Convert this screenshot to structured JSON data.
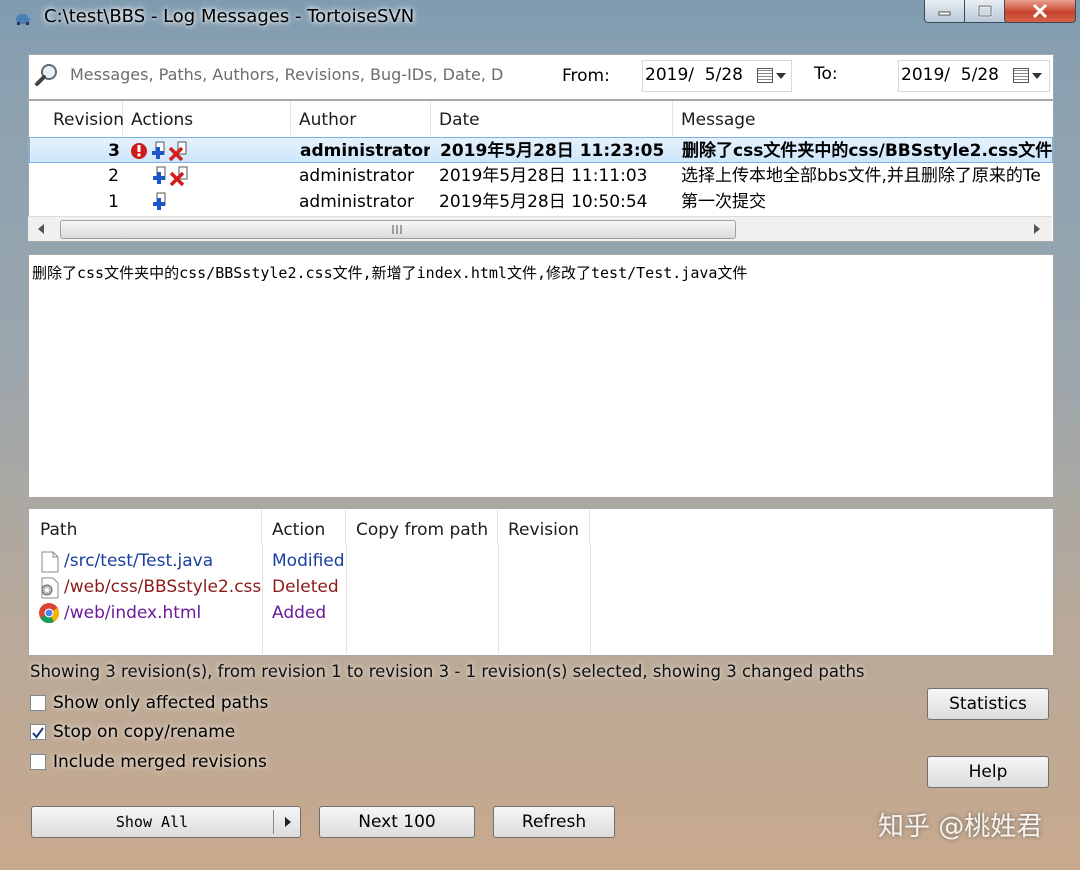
{
  "window": {
    "title": "C:\\test\\BBS - Log Messages - TortoiseSVN"
  },
  "search": {
    "placeholder": "Messages, Paths, Authors, Revisions, Bug-IDs, Date, D",
    "from_label": "From:",
    "from_value": "2019/  5/28",
    "to_label": "To:",
    "to_value": "2019/  5/28"
  },
  "revisions": {
    "headers": [
      "Revision",
      "Actions",
      "Author",
      "Date",
      "Message"
    ],
    "rows": [
      {
        "revision": "3",
        "author": "administrator",
        "date": "2019年5月28日 11:23:05",
        "message": "删除了css文件夹中的css/BBSstyle2.css文件",
        "actions": [
          "conflict",
          "add",
          "delete"
        ],
        "selected": true
      },
      {
        "revision": "2",
        "author": "administrator",
        "date": "2019年5月28日 11:11:03",
        "message": "选择上传本地全部bbs文件,并且删除了原来的Te",
        "actions": [
          "add",
          "delete"
        ],
        "selected": false
      },
      {
        "revision": "1",
        "author": "administrator",
        "date": "2019年5月28日 10:50:54",
        "message": "第一次提交",
        "actions": [
          "add"
        ],
        "selected": false
      }
    ]
  },
  "message_text": "删除了css文件夹中的css/BBSstyle2.css文件,新增了index.html文件,修改了test/Test.java文件",
  "paths": {
    "headers": [
      "Path",
      "Action",
      "Copy from path",
      "Revision"
    ],
    "rows": [
      {
        "path": "/src/test/Test.java",
        "action": "Modified",
        "color": "#1b3f9e",
        "icon": "file-icon"
      },
      {
        "path": "/web/css/BBSstyle2.css",
        "action": "Deleted",
        "color": "#8b1a1a",
        "icon": "css-file-icon"
      },
      {
        "path": "/web/index.html",
        "action": "Added",
        "color": "#6a1b9a",
        "icon": "chrome-icon"
      }
    ]
  },
  "status": "Showing 3 revision(s), from revision 1 to revision 3 - 1 revision(s) selected, showing 3 changed paths",
  "options": {
    "show_affected": "Show only affected paths",
    "stop_copy": "Stop on copy/rename",
    "include_merged": "Include merged revisions"
  },
  "buttons": {
    "statistics": "Statistics",
    "help": "Help",
    "show_all": "Show All",
    "next100": "Next 100",
    "refresh": "Refresh"
  },
  "watermark": "知乎 @桃姓君"
}
